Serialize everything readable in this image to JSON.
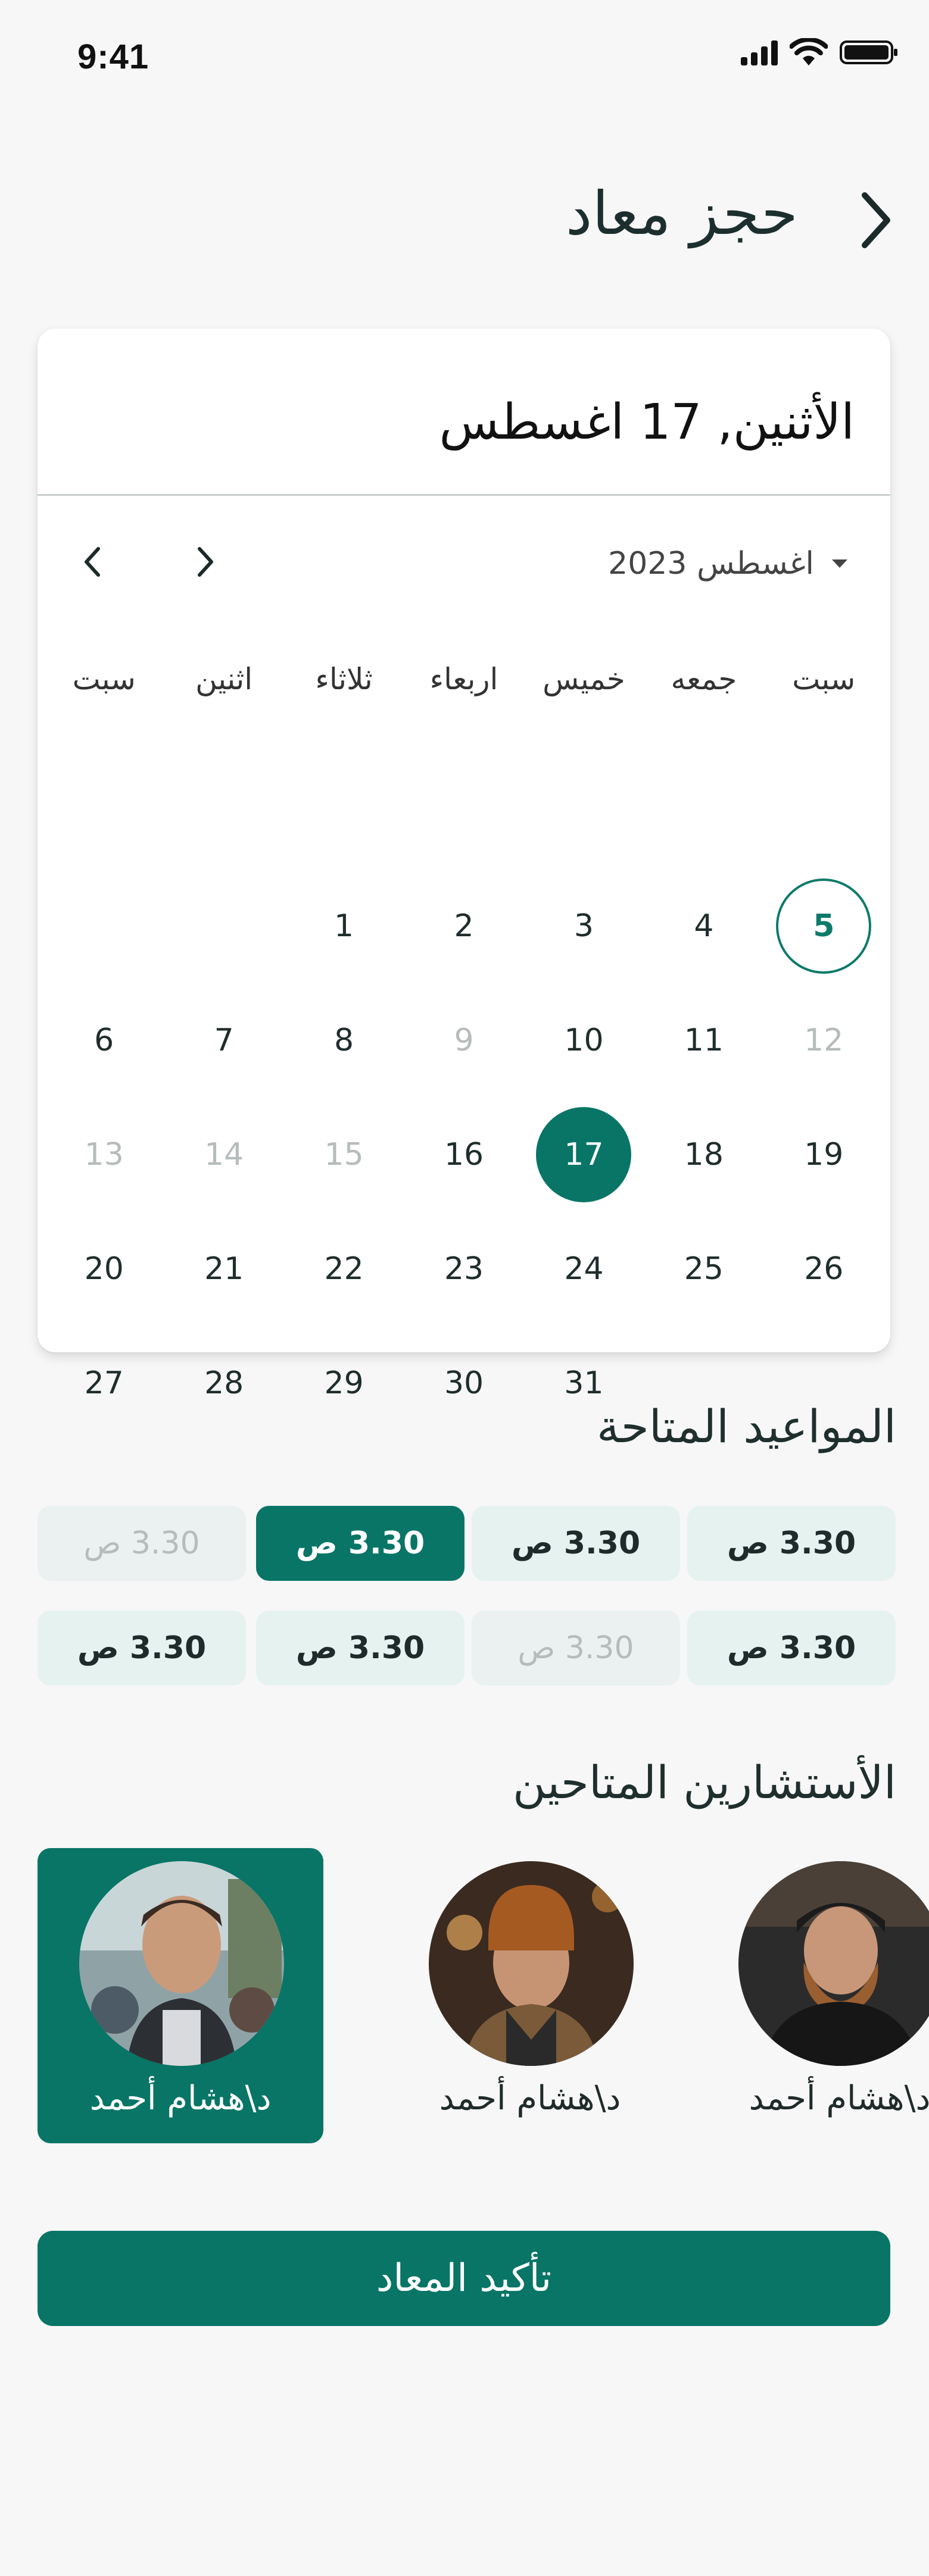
{
  "status_bar": {
    "time": "9:41",
    "icons": [
      "signal-icon",
      "wifi-icon",
      "battery-icon"
    ]
  },
  "header": {
    "title": "حجز معاد",
    "back_icon": "chevron-right-icon"
  },
  "calendar": {
    "selected_date_label": "الأثنين, 17 اغسطس",
    "month_label": "اغسطس 2023",
    "weekdays": [
      "سبت",
      "جمعه",
      "خميس",
      "اربعاء",
      "ثلاثاء",
      "اثنين",
      "سبت"
    ],
    "days": [
      {
        "label": "",
        "state": "empty"
      },
      {
        "label": "",
        "state": "empty"
      },
      {
        "label": "",
        "state": "empty"
      },
      {
        "label": "",
        "state": "empty"
      },
      {
        "label": "",
        "state": "empty"
      },
      {
        "label": "",
        "state": "empty"
      },
      {
        "label": "",
        "state": "empty"
      },
      {
        "label": "5",
        "state": "today"
      },
      {
        "label": "4",
        "state": "normal"
      },
      {
        "label": "3",
        "state": "normal"
      },
      {
        "label": "2",
        "state": "normal"
      },
      {
        "label": "1",
        "state": "normal"
      },
      {
        "label": "",
        "state": "empty"
      },
      {
        "label": "",
        "state": "empty"
      },
      {
        "label": "12",
        "state": "muted"
      },
      {
        "label": "11",
        "state": "normal"
      },
      {
        "label": "10",
        "state": "normal"
      },
      {
        "label": "9",
        "state": "muted"
      },
      {
        "label": "8",
        "state": "normal"
      },
      {
        "label": "7",
        "state": "normal"
      },
      {
        "label": "6",
        "state": "normal"
      },
      {
        "label": "19",
        "state": "normal"
      },
      {
        "label": "18",
        "state": "normal"
      },
      {
        "label": "17",
        "state": "selected"
      },
      {
        "label": "16",
        "state": "normal"
      },
      {
        "label": "15",
        "state": "muted"
      },
      {
        "label": "14",
        "state": "muted"
      },
      {
        "label": "13",
        "state": "muted"
      },
      {
        "label": "26",
        "state": "normal"
      },
      {
        "label": "25",
        "state": "normal"
      },
      {
        "label": "24",
        "state": "normal"
      },
      {
        "label": "23",
        "state": "normal"
      },
      {
        "label": "22",
        "state": "normal"
      },
      {
        "label": "21",
        "state": "normal"
      },
      {
        "label": "20",
        "state": "normal"
      },
      {
        "label": "",
        "state": "empty"
      },
      {
        "label": "",
        "state": "empty"
      },
      {
        "label": "31",
        "state": "normal"
      },
      {
        "label": "30",
        "state": "normal"
      },
      {
        "label": "29",
        "state": "normal"
      },
      {
        "label": "28",
        "state": "normal"
      },
      {
        "label": "27",
        "state": "normal"
      }
    ]
  },
  "slots_section": {
    "title": "المواعيد المتاحة",
    "slots": [
      {
        "label": "3.30 ص",
        "state": "available"
      },
      {
        "label": "3.30 ص",
        "state": "available"
      },
      {
        "label": "3.30 ص",
        "state": "selected"
      },
      {
        "label": "3.30 ص",
        "state": "disabled"
      },
      {
        "label": "3.30 ص",
        "state": "available"
      },
      {
        "label": "3.30 ص",
        "state": "disabled"
      },
      {
        "label": "3.30 ص",
        "state": "available"
      },
      {
        "label": "3.30 ص",
        "state": "available"
      }
    ]
  },
  "consultants_section": {
    "title": "الأستشارين المتاحين",
    "consultants": [
      {
        "name": "د\\هشام أحمد",
        "selected": true
      },
      {
        "name": "د\\هشام أحمد",
        "selected": false
      },
      {
        "name": "د\\هشام أحمد",
        "selected": false
      }
    ]
  },
  "confirm_button": {
    "label": "تأكيد المعاد"
  },
  "colors": {
    "primary": "#087566",
    "slot_bg": "#e6f2f0",
    "muted_text": "#b6bcbb"
  }
}
